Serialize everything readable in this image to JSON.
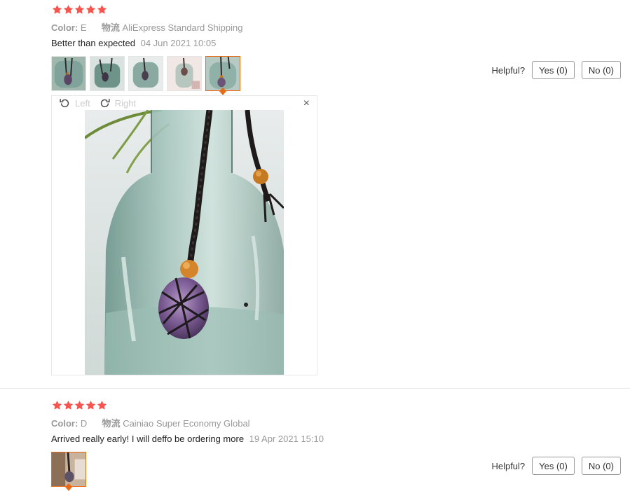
{
  "colors": {
    "star": "#f5544f",
    "accent": "#e86b1a",
    "muted": "#999999"
  },
  "reviews": [
    {
      "rating": 5,
      "meta": {
        "color_key": "Color:",
        "color_value": "E",
        "logistics_key": "物流",
        "logistics_value": "AliExpress Standard Shipping"
      },
      "text": "Better than expected",
      "date": "04 Jun 2021 10:05",
      "helpful_label": "Helpful?",
      "yes_label": "Yes (0)",
      "no_label": "No (0)",
      "viewer": {
        "left_label": "Left",
        "right_label": "Right",
        "close_icon": "×"
      }
    },
    {
      "rating": 5,
      "meta": {
        "color_key": "Color:",
        "color_value": "D",
        "logistics_key": "物流",
        "logistics_value": "Cainiao Super Economy Global"
      },
      "text": "Arrived really early! I will deffo be ordering more",
      "date": "19 Apr 2021 15:10",
      "helpful_label": "Helpful?",
      "yes_label": "Yes (0)",
      "no_label": "No (0)"
    }
  ]
}
